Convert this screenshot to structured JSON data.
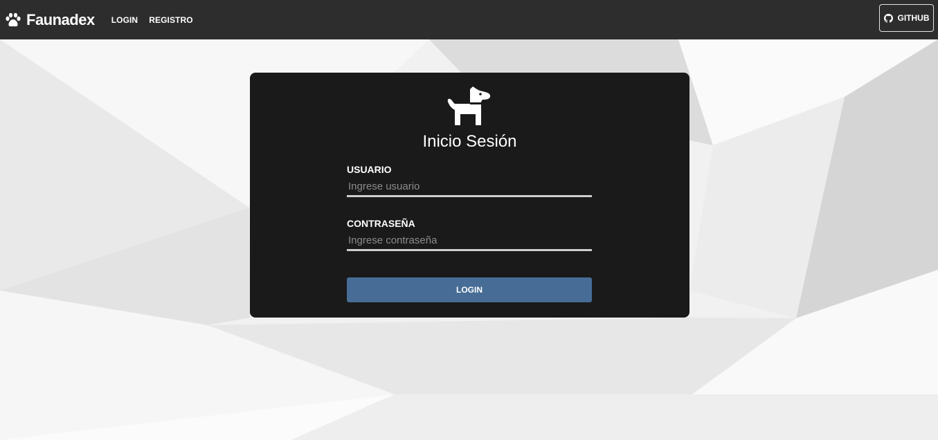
{
  "navbar": {
    "brand": "Faunadex",
    "brand_icon": "paw-icon",
    "links": [
      "LOGIN",
      "REGISTRO"
    ],
    "github_label": "GITHUB",
    "github_icon": "github-icon",
    "background_color": "#2d2d2d"
  },
  "login_card": {
    "icon": "dog-icon",
    "title": "Inicio Sesión",
    "username": {
      "label": "USUARIO",
      "placeholder": "Ingrese usuario",
      "value": ""
    },
    "password": {
      "label": "CONTRASEÑA",
      "placeholder": "Ingrese contraseña",
      "value": ""
    },
    "submit_label": "LOGIN",
    "background_color": "#1a1a1a",
    "button_color": "#476d96"
  }
}
